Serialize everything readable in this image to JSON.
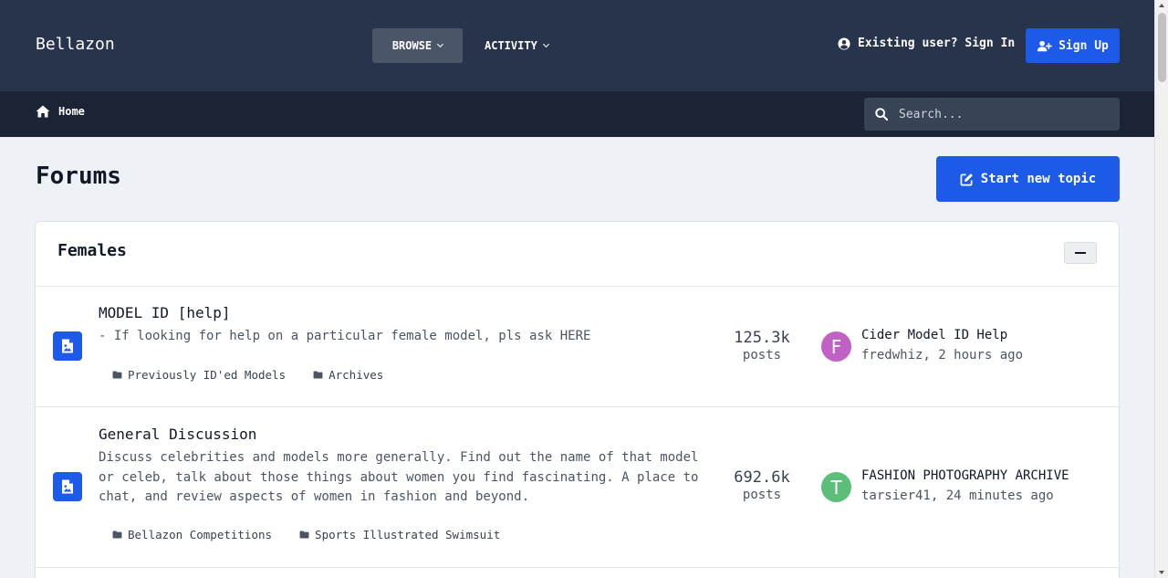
{
  "header": {
    "brand": "Bellazon",
    "nav": [
      {
        "label": "BROWSE",
        "active": true
      },
      {
        "label": "ACTIVITY",
        "active": false
      }
    ],
    "signin_label": "Existing user? Sign In",
    "signup_label": "Sign Up"
  },
  "subnav": {
    "home_label": "Home",
    "search_placeholder": "Search..."
  },
  "page": {
    "title": "Forums",
    "new_topic_label": "Start new topic"
  },
  "section": {
    "title": "Females",
    "forums": [
      {
        "title": "MODEL ID [help]",
        "description": "- If looking for help on a particular female model, pls ask HERE",
        "subforums": [
          "Previously ID'ed Models",
          "Archives"
        ],
        "posts_count": "125.3k",
        "posts_label": "posts",
        "last_post": {
          "avatar_letter": "F",
          "avatar_color": "#c062c4",
          "title": "Cider Model ID Help",
          "meta": "fredwhiz, 2 hours ago"
        }
      },
      {
        "title": "General Discussion",
        "description": "Discuss celebrities and models more generally. Find out the name of that model or celeb, talk about those things about women you find fascinating. A place to chat, and review aspects of women in fashion and beyond.",
        "subforums": [
          "Bellazon Competitions",
          "Sports Illustrated Swimsuit"
        ],
        "posts_count": "692.6k",
        "posts_label": "posts",
        "last_post": {
          "avatar_letter": "T",
          "avatar_color": "#5bbf7a",
          "title": "FASHION PHOTOGRAPHY ARCHIVE",
          "meta": "tarsier41, 24 minutes ago"
        }
      }
    ]
  },
  "colors": {
    "header_bg": "#27344b",
    "subnav_bg": "#1b2434",
    "accent": "#1e5ae8",
    "page_bg": "#eef1f5"
  },
  "icons": {
    "signin": "user-circle-icon",
    "signup": "user-plus-icon",
    "home": "home-icon",
    "search": "search-icon",
    "new_topic": "pen-square-icon",
    "forum": "file-image-icon",
    "subforum": "folder-icon",
    "collapse": "minus-icon"
  }
}
